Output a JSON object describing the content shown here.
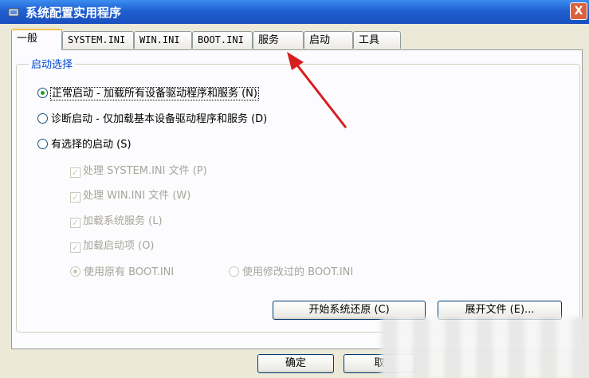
{
  "window": {
    "title": "系统配置实用程序",
    "close_label": "X"
  },
  "tabs": [
    {
      "label": "一般",
      "active": true
    },
    {
      "label": "SYSTEM.INI"
    },
    {
      "label": "WIN.INI"
    },
    {
      "label": "BOOT.INI"
    },
    {
      "label": "服务"
    },
    {
      "label": "启动"
    },
    {
      "label": "工具"
    }
  ],
  "startup": {
    "group_label": "启动选择",
    "normal": "正常启动 - 加载所有设备驱动程序和服务 (N)",
    "diagnostic": "诊断启动 - 仅加载基本设备驱动程序和服务 (D)",
    "selective": "有选择的启动 (S)",
    "options": [
      {
        "label": "处理 SYSTEM.INI 文件 (P)"
      },
      {
        "label": "处理 WIN.INI 文件 (W)"
      },
      {
        "label": "加载系统服务 (L)"
      },
      {
        "label": "加载启动项 (O)"
      }
    ],
    "use_original": "使用原有 BOOT.INI",
    "use_modified": "使用修改过的 BOOT.INI"
  },
  "buttons": {
    "restore": "开始系统还原 (C)",
    "expand": "展开文件 (E)...",
    "ok": "确定",
    "cancel": "取"
  },
  "colors": {
    "titlebar": "#1f5fd0",
    "group_label": "#0046d5",
    "annotation_arrow": "#d62020"
  }
}
